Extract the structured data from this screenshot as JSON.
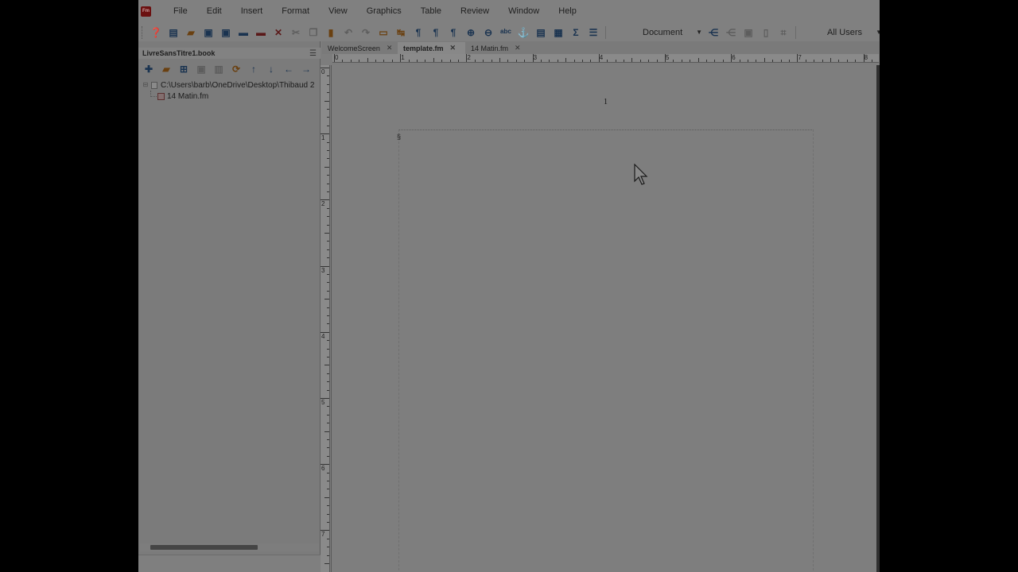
{
  "menu": {
    "logo_text": "Fm",
    "items": [
      "File",
      "Edit",
      "Insert",
      "Format",
      "View",
      "Graphics",
      "Table",
      "Review",
      "Window",
      "Help"
    ]
  },
  "toolbar": {
    "buttons": [
      {
        "name": "help-icon",
        "glyph": "❓",
        "tone": "blue"
      },
      {
        "name": "new-document-icon",
        "glyph": "▤",
        "tone": "blue"
      },
      {
        "name": "open-folder-icon",
        "glyph": "▰",
        "tone": "orange"
      },
      {
        "name": "save-icon",
        "glyph": "▣",
        "tone": "blue"
      },
      {
        "name": "save-all-icon",
        "glyph": "▣",
        "tone": "blue"
      },
      {
        "name": "print-icon",
        "glyph": "▬",
        "tone": "blue"
      },
      {
        "name": "lock-icon",
        "glyph": "▬",
        "tone": "red"
      },
      {
        "name": "delete-icon",
        "glyph": "✕",
        "tone": "red"
      },
      {
        "name": "cut-icon",
        "glyph": "✂",
        "tone": "dim"
      },
      {
        "name": "copy-icon",
        "glyph": "❐",
        "tone": "dim"
      },
      {
        "name": "paste-icon",
        "glyph": "▮",
        "tone": "orange"
      },
      {
        "name": "undo-icon",
        "glyph": "↶",
        "tone": "dim"
      },
      {
        "name": "redo-icon",
        "glyph": "↷",
        "tone": "dim"
      },
      {
        "name": "rotate-icon",
        "glyph": "▭",
        "tone": "orange"
      },
      {
        "name": "history-icon",
        "glyph": "↹",
        "tone": "orange"
      },
      {
        "name": "paragraph-format-icon",
        "glyph": "¶",
        "tone": "blue"
      },
      {
        "name": "character-format-icon",
        "glyph": "¶",
        "tone": "blue"
      },
      {
        "name": "table-format-icon",
        "glyph": "¶",
        "tone": "blue"
      },
      {
        "name": "zoom-in-icon",
        "glyph": "⊕",
        "tone": "blue"
      },
      {
        "name": "zoom-out-icon",
        "glyph": "⊖",
        "tone": "blue"
      },
      {
        "name": "spell-check-icon",
        "glyph": "ᵃᵇᶜ",
        "tone": "blue"
      },
      {
        "name": "anchor-icon",
        "glyph": "⚓",
        "tone": "blue"
      },
      {
        "name": "frame-icon",
        "glyph": "▤",
        "tone": "blue"
      },
      {
        "name": "table-icon",
        "glyph": "▦",
        "tone": "blue"
      },
      {
        "name": "sigma-icon",
        "glyph": "Σ",
        "tone": "blue"
      },
      {
        "name": "paragraph-designer-icon",
        "glyph": "☰",
        "tone": "blue"
      }
    ],
    "document_select": "Document",
    "right_buttons": [
      {
        "name": "link-back-icon",
        "glyph": "⋲",
        "tone": "blue"
      },
      {
        "name": "link-broken-icon",
        "glyph": "⋲",
        "tone": "dim"
      },
      {
        "name": "fit-window-icon",
        "glyph": "▣",
        "tone": "dim"
      },
      {
        "name": "page-icon",
        "glyph": "▯",
        "tone": "dim"
      },
      {
        "name": "crop-icon",
        "glyph": "⌗",
        "tone": "dim"
      }
    ],
    "users_select": "All Users"
  },
  "book": {
    "title": "LivreSansTitre1.book",
    "toolbar_buttons": [
      {
        "name": "add-file-icon",
        "glyph": "✚",
        "tone": "blue"
      },
      {
        "name": "add-folder-icon",
        "glyph": "▰",
        "tone": "orange"
      },
      {
        "name": "add-group-icon",
        "glyph": "⊞",
        "tone": "blue"
      },
      {
        "name": "save-book-icon",
        "glyph": "▣",
        "tone": "dim"
      },
      {
        "name": "remove-icon",
        "glyph": "▥",
        "tone": "dim"
      },
      {
        "name": "update-book-icon",
        "glyph": "⟳",
        "tone": "orange"
      },
      {
        "name": "move-up-icon",
        "glyph": "↑",
        "tone": "blue"
      },
      {
        "name": "move-down-icon",
        "glyph": "↓",
        "tone": "blue"
      },
      {
        "name": "move-left-icon",
        "glyph": "←",
        "tone": "blue"
      },
      {
        "name": "move-right-icon",
        "glyph": "→",
        "tone": "blue"
      }
    ],
    "root_path": "C:\\Users\\barb\\OneDrive\\Desktop\\Thibaud 2",
    "child_file": "14 Matin.fm"
  },
  "tabs": [
    {
      "label": "WelcomeScreen",
      "active": false
    },
    {
      "label": "template.fm",
      "active": true
    },
    {
      "label": "14 Matin.fm",
      "active": false
    }
  ],
  "rulers": {
    "horizontal_labels": [
      "0",
      "1",
      "2",
      "3",
      "4",
      "5",
      "6",
      "7",
      "8"
    ],
    "vertical_labels": [
      "0",
      "1",
      "2",
      "3",
      "4",
      "5",
      "6",
      "7"
    ]
  },
  "document": {
    "page_number": "1",
    "text_marker": "§"
  }
}
